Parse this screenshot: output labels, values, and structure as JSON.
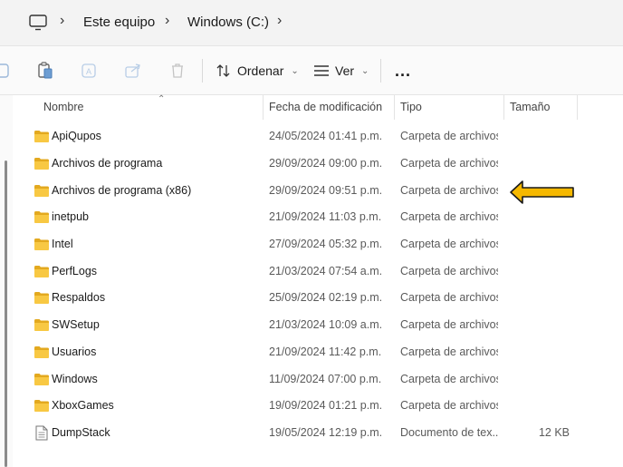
{
  "address_bar": {
    "icon": "computer-icon",
    "breadcrumbs": [
      "Este equipo",
      "Windows (C:)"
    ]
  },
  "toolbar": {
    "icons": [
      "new-icon",
      "paste-icon",
      "rename-icon",
      "share-icon",
      "delete-icon"
    ],
    "sort_label": "Ordenar",
    "view_label": "Ver",
    "more_label": "..."
  },
  "columns": {
    "name": "Nombre",
    "date": "Fecha de modificación",
    "type": "Tipo",
    "size": "Tamaño"
  },
  "items": [
    {
      "name": "ApiQupos",
      "date": "24/05/2024 01:41 p.m.",
      "type": "Carpeta de archivos",
      "size": "",
      "icon": "folder-icon"
    },
    {
      "name": "Archivos de programa",
      "date": "29/09/2024 09:00 p.m.",
      "type": "Carpeta de archivos",
      "size": "",
      "icon": "folder-icon"
    },
    {
      "name": "Archivos de programa (x86)",
      "date": "29/09/2024 09:51 p.m.",
      "type": "Carpeta de archivos",
      "size": "",
      "icon": "folder-icon"
    },
    {
      "name": "inetpub",
      "date": "21/09/2024 11:03 p.m.",
      "type": "Carpeta de archivos",
      "size": "",
      "icon": "folder-icon"
    },
    {
      "name": "Intel",
      "date": "27/09/2024 05:32 p.m.",
      "type": "Carpeta de archivos",
      "size": "",
      "icon": "folder-icon"
    },
    {
      "name": "PerfLogs",
      "date": "21/03/2024 07:54 a.m.",
      "type": "Carpeta de archivos",
      "size": "",
      "icon": "folder-icon"
    },
    {
      "name": "Respaldos",
      "date": "25/09/2024 02:19 p.m.",
      "type": "Carpeta de archivos",
      "size": "",
      "icon": "folder-icon"
    },
    {
      "name": "SWSetup",
      "date": "21/03/2024 10:09 a.m.",
      "type": "Carpeta de archivos",
      "size": "",
      "icon": "folder-icon"
    },
    {
      "name": "Usuarios",
      "date": "21/09/2024 11:42 p.m.",
      "type": "Carpeta de archivos",
      "size": "",
      "icon": "folder-icon"
    },
    {
      "name": "Windows",
      "date": "11/09/2024 07:00 p.m.",
      "type": "Carpeta de archivos",
      "size": "",
      "icon": "folder-icon"
    },
    {
      "name": "XboxGames",
      "date": "19/09/2024 01:21 p.m.",
      "type": "Carpeta de archivos",
      "size": "",
      "icon": "folder-icon"
    },
    {
      "name": "DumpStack",
      "date": "19/05/2024 12:19 p.m.",
      "type": "Documento de tex...",
      "size": "12 KB",
      "icon": "text-file-icon"
    }
  ],
  "annotation": {
    "icon": "arrow-left-icon",
    "color": "#f5b800"
  },
  "colors": {
    "folder": "#f8c843",
    "folder_dark": "#e3a91f",
    "accent_arrow": "#f5b800"
  }
}
